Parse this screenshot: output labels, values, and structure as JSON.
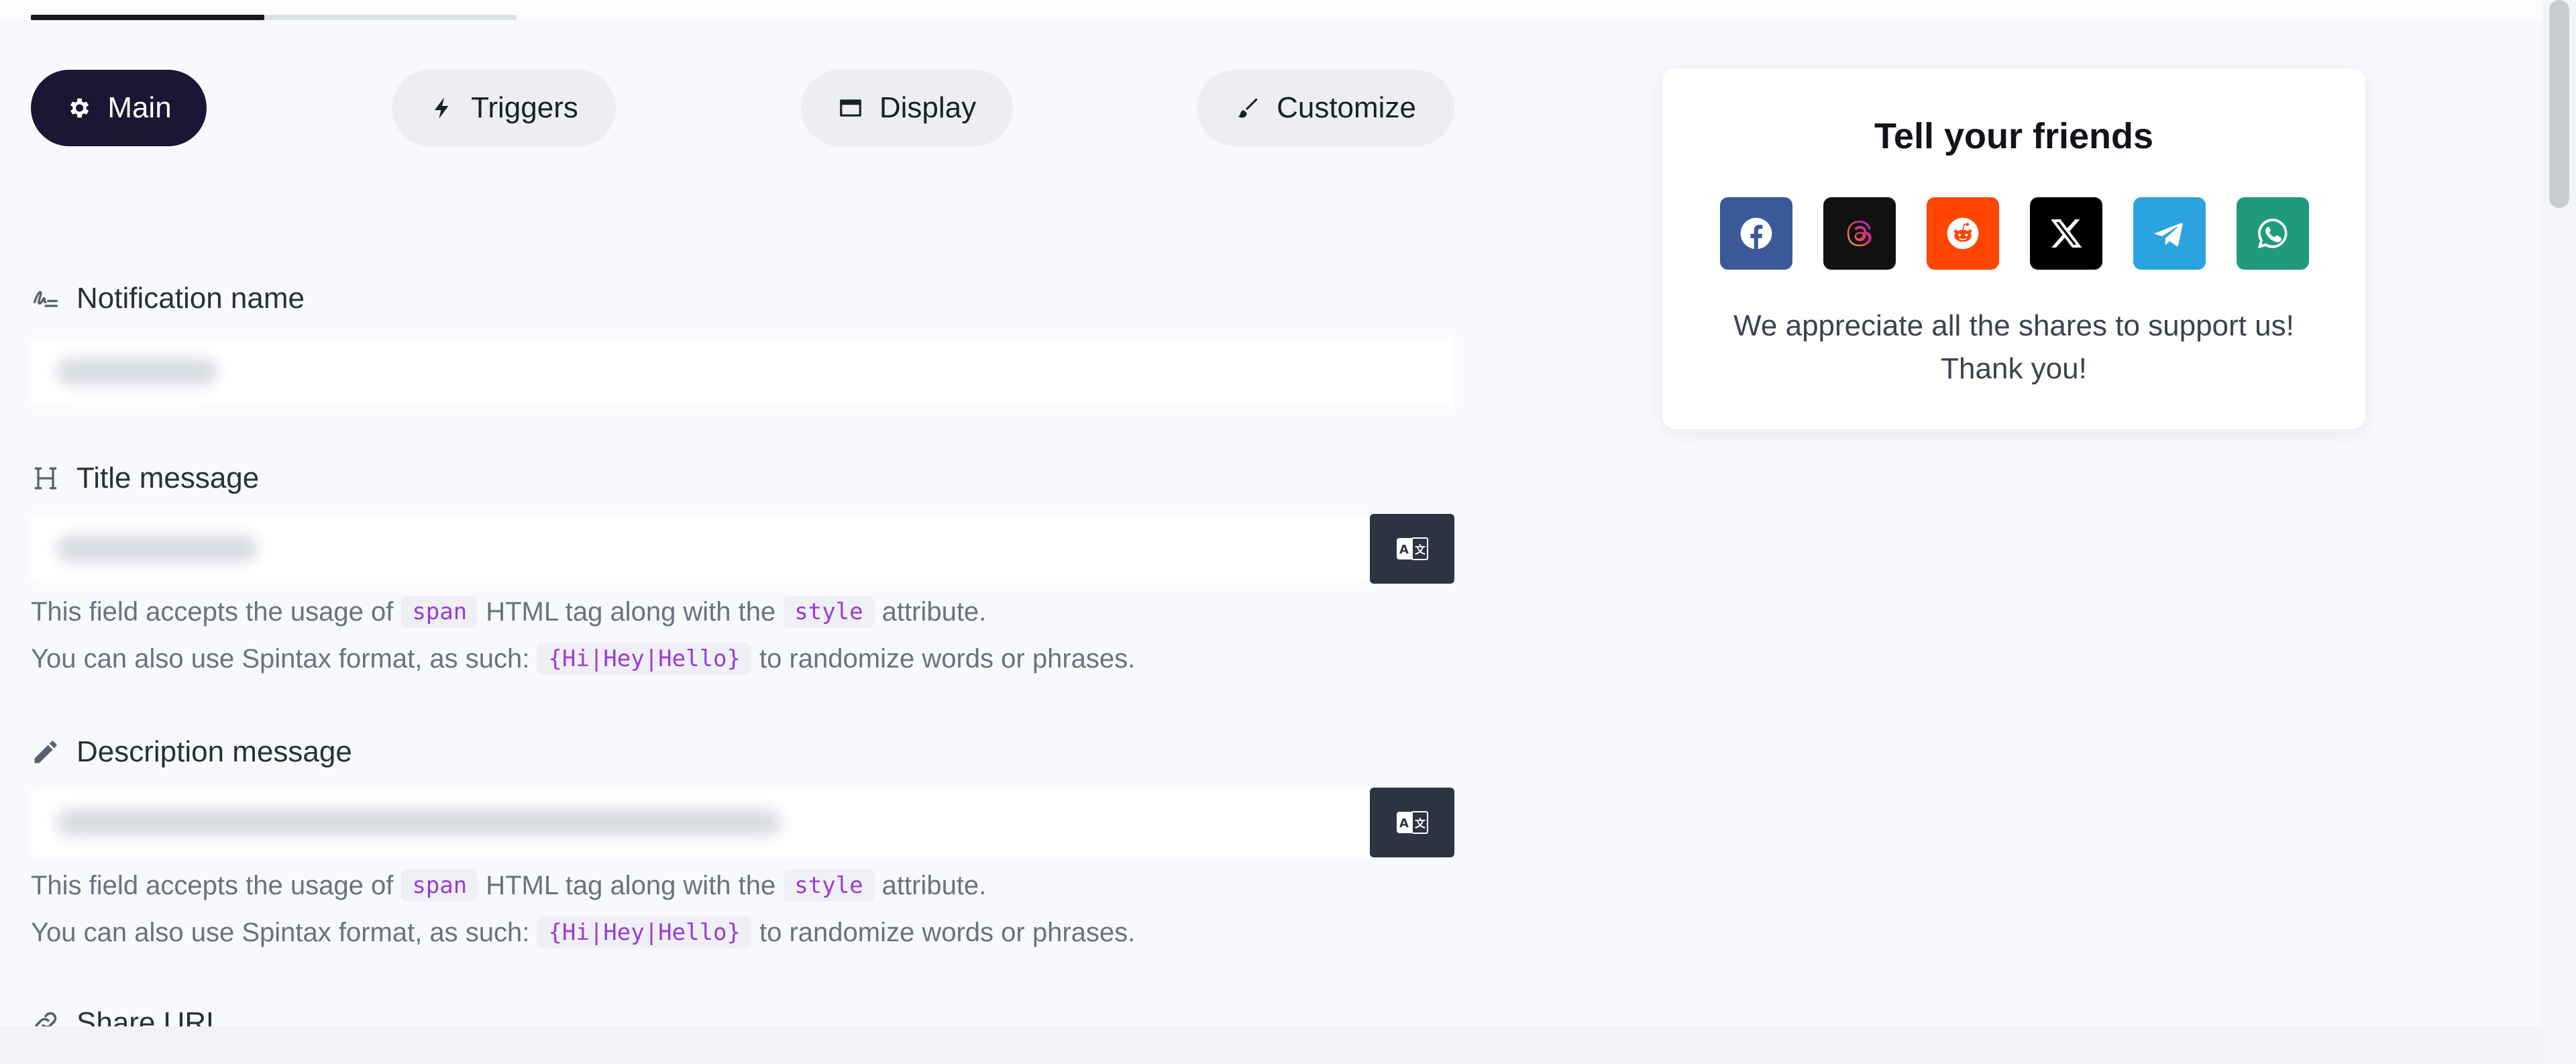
{
  "progress": {
    "fraction": 0.48
  },
  "tabs": [
    {
      "label": "Main",
      "icon": "gear-icon",
      "active": true
    },
    {
      "label": "Triggers",
      "icon": "bolt-icon",
      "active": false
    },
    {
      "label": "Display",
      "icon": "window-icon",
      "active": false
    },
    {
      "label": "Customize",
      "icon": "paintbrush-icon",
      "active": false
    }
  ],
  "form": {
    "notification_name": {
      "label": "Notification name",
      "icon": "signature-icon"
    },
    "title_message": {
      "label": "Title message",
      "icon": "heading-icon",
      "help1": {
        "pre": "This field accepts the usage of",
        "code1": "span",
        "mid": "HTML tag along with the",
        "code2": "style",
        "post": "attribute."
      },
      "help2": {
        "pre": "You can also use Spintax format, as such:",
        "code": "{Hi|Hey|Hello}",
        "post": "to randomize words or phrases."
      }
    },
    "description_message": {
      "label": "Description message",
      "icon": "pencil-icon",
      "help1": {
        "pre": "This field accepts the usage of",
        "code1": "span",
        "mid": "HTML tag along with the",
        "code2": "style",
        "post": "attribute."
      },
      "help2": {
        "pre": "You can also use Spintax format, as such:",
        "code": "{Hi|Hey|Hello}",
        "post": "to randomize words or phrases."
      }
    },
    "share_url": {
      "label": "Share URL",
      "icon": "link-icon"
    }
  },
  "share": {
    "title": "Tell your friends",
    "line1": "We appreciate all the shares to support us!",
    "line2": "Thank you!",
    "networks": [
      {
        "name": "facebook-icon",
        "color": "#3b5998"
      },
      {
        "name": "threads-icon",
        "color": "#111111"
      },
      {
        "name": "reddit-icon",
        "color": "#ff4500"
      },
      {
        "name": "x-icon",
        "color": "#000000"
      },
      {
        "name": "telegram-icon",
        "color": "#2aa3e0"
      },
      {
        "name": "whatsapp-icon",
        "color": "#1f9a7c"
      }
    ]
  },
  "colors": {
    "accent": "#1b1633",
    "code": "#9a3bd4",
    "translate_button": "#2c3443"
  }
}
